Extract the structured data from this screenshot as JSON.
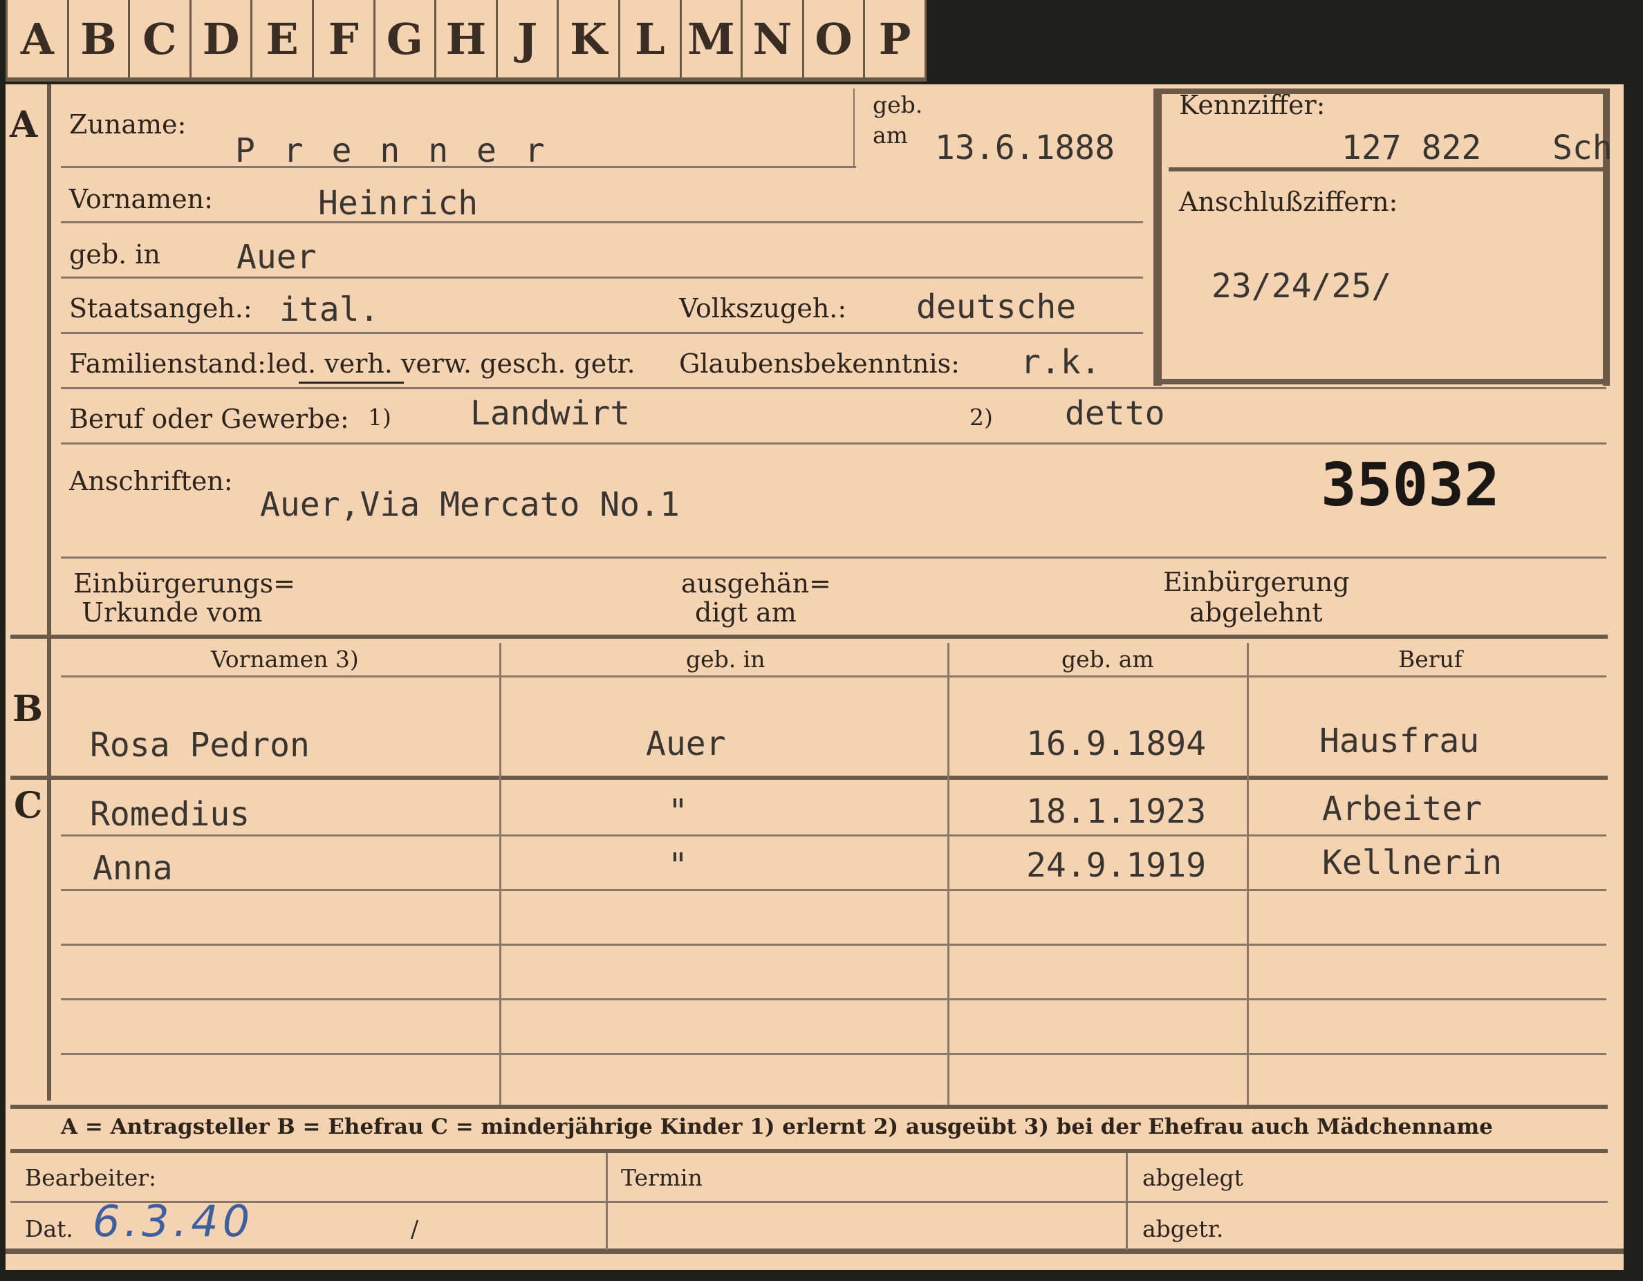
{
  "tabs": [
    "A",
    "B",
    "C",
    "D",
    "E",
    "F",
    "G",
    "H",
    "J",
    "K",
    "L",
    "M",
    "N",
    "O",
    "P"
  ],
  "sections": {
    "a": "A",
    "b": "B",
    "c": "C"
  },
  "labels": {
    "zuname": "Zuname:",
    "geb_am_1": "geb.",
    "geb_am_2": "am",
    "kennziffer": "Kennziffer:",
    "vornamen": "Vornamen:",
    "anschlussziffern": "Anschlußziffern:",
    "geb_in": "geb. in",
    "staatsangeh": "Staatsangeh.:",
    "volkszugeh": "Volkszugeh.:",
    "familienstand": "Familienstand:",
    "familienstand_options": "led. verh. verw. gesch. getr.",
    "glaubensbekenntnis": "Glaubensbekenntnis:",
    "beruf_oder_gewerbe": "Beruf oder Gewerbe:",
    "beruf_mark_1": "1)",
    "beruf_mark_2": "2)",
    "anschriften": "Anschriften:",
    "einb_urkunde_1": "Einbürgerungs=",
    "einb_urkunde_2": "Urkunde vom",
    "ausgehaendigt_1": "ausgehän=",
    "ausgehaendigt_2": "digt am",
    "einb_abgelehnt_1": "Einbürgerung",
    "einb_abgelehnt_2": "abgelehnt"
  },
  "person": {
    "zuname": "P r e n n e r",
    "geb_am": "13.6.1888",
    "kennziffer": "127 822",
    "kennziffer_suffix": "Sch",
    "vornamen": "Heinrich",
    "anschlussziffern": "23/24/25/",
    "geb_in": "Auer",
    "staatsangeh": "ital.",
    "volkszugeh": "deutsche",
    "glaubensbekenntnis": "r.k.",
    "beruf_erlernt": "Landwirt",
    "beruf_ausgeuebt": "detto",
    "anschrift": "Auer,Via Mercato No.1",
    "stamp_number": "35032"
  },
  "table": {
    "headers": [
      "Vornamen 3)",
      "geb. in",
      "geb. am",
      "Beruf"
    ],
    "ehefrau": {
      "vornamen": "Rosa  Pedron",
      "geb_in": "Auer",
      "geb_am": "16.9.1894",
      "beruf": "Hausfrau"
    },
    "kinder": [
      {
        "vornamen": "Romedius",
        "geb_in": "\"",
        "geb_am": "18.1.1923",
        "beruf": "Arbeiter"
      },
      {
        "vornamen": "Anna",
        "geb_in": "\"",
        "geb_am": "24.9.1919",
        "beruf": "Kellnerin"
      }
    ]
  },
  "legend": "A = Antragsteller   B = Ehefrau   C = minderjährige Kinder   1) erlernt   2) ausgeübt   3) bei der Ehefrau auch Mädchenname",
  "footer": {
    "bearbeiter": "Bearbeiter:",
    "dat": "Dat.",
    "dat_value": "6.3.40",
    "slash": "/",
    "termin": "Termin",
    "abgelegt": "abgelegt",
    "abgetr": "abgetr."
  }
}
